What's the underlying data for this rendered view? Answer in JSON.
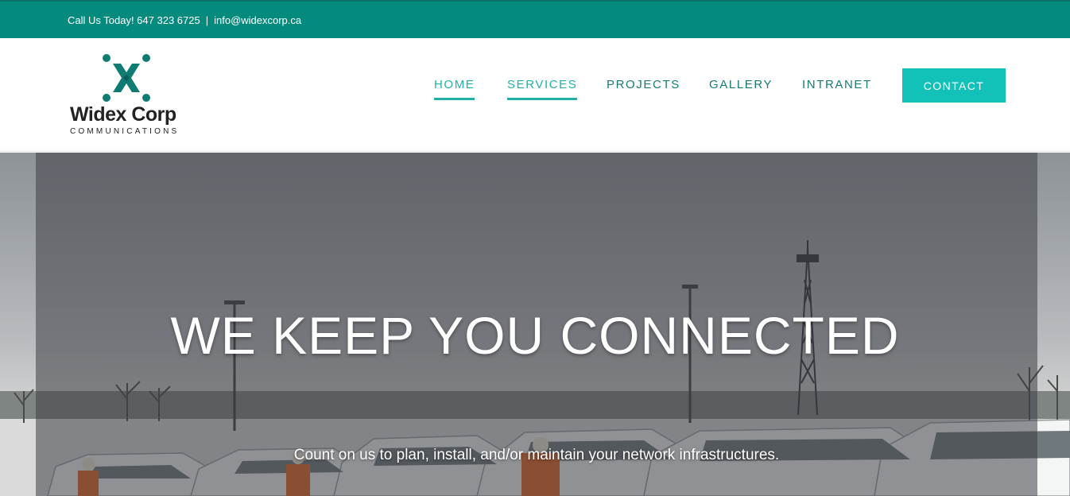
{
  "topbar": {
    "phone_text": "Call Us Today! 647 323 6725",
    "separator": "|",
    "email": "info@widexcorp.ca"
  },
  "logo": {
    "name": "Widex Corp",
    "subtitle": "COMMUNICATIONS"
  },
  "nav": {
    "items": [
      {
        "label": "HOME",
        "active": true
      },
      {
        "label": "SERVICES",
        "active": true
      },
      {
        "label": "PROJECTS",
        "active": false
      },
      {
        "label": "GALLERY",
        "active": false
      },
      {
        "label": "INTRANET",
        "active": false
      }
    ],
    "contact_label": "CONTACT"
  },
  "hero": {
    "title": "WE KEEP YOU CONNECTED",
    "subtitle": "Count on us to plan, install, and/or maintain your network infrastructures."
  },
  "colors": {
    "topbar": "#058a7e",
    "accent": "#12c1b8",
    "nav_text": "#177a75",
    "logo_mark": "#0e7c72"
  }
}
